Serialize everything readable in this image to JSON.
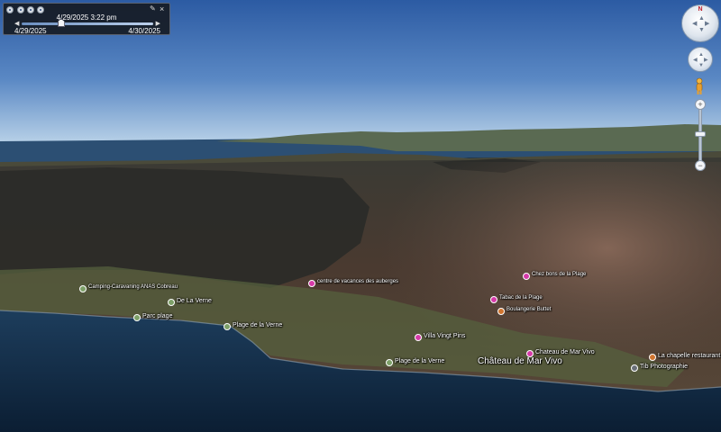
{
  "time_slider": {
    "current": "4/29/2025   3:22 pm",
    "start": "4/29/2025",
    "end": "4/30/2025",
    "position": 0.3
  },
  "places": [
    {
      "text": "Château de Mar Vivo",
      "size": "l",
      "pin": "none"
    },
    {
      "text": "Chateau de Mar Vivo",
      "size": "m",
      "pin": "pink"
    },
    {
      "text": "Villa Vingt Pins",
      "size": "m",
      "pin": "pink"
    },
    {
      "text": "Plage de la Verne",
      "size": "m",
      "pin": "green"
    },
    {
      "text": "Plage de la Verne",
      "size": "m",
      "pin": "green"
    },
    {
      "text": "Parc plage",
      "size": "m",
      "pin": "green"
    },
    {
      "text": "De La Verne",
      "size": "m",
      "pin": "green"
    },
    {
      "text": "Camping-Caravaning ANAS Cobreau",
      "size": "s",
      "pin": "green"
    },
    {
      "text": "centre de vacances des auberges",
      "size": "s",
      "pin": "pink"
    },
    {
      "text": "Boulangerie Buttet",
      "size": "s",
      "pin": "orange"
    },
    {
      "text": "Tabac de la Plage",
      "size": "s",
      "pin": "pink"
    },
    {
      "text": "Chez bons de la Plage",
      "size": "s",
      "pin": "pink"
    },
    {
      "text": "La chapelle restaurant",
      "size": "m",
      "pin": "orange"
    },
    {
      "text": "Tib Photographie",
      "size": "m",
      "pin": "grey"
    }
  ],
  "colors": {
    "sky_top": "#2c5ba3",
    "sky_horizon": "#b9d2e8",
    "sea_deep": "#0b1e33",
    "sea_far": "#1d3d5c",
    "pin_pink": "#d63aa8",
    "pin_green": "#7da068",
    "pin_orange": "#d0742e"
  },
  "icons": {
    "compass": "compass-ring-icon",
    "north": "N",
    "pegman": "pegman-icon"
  }
}
